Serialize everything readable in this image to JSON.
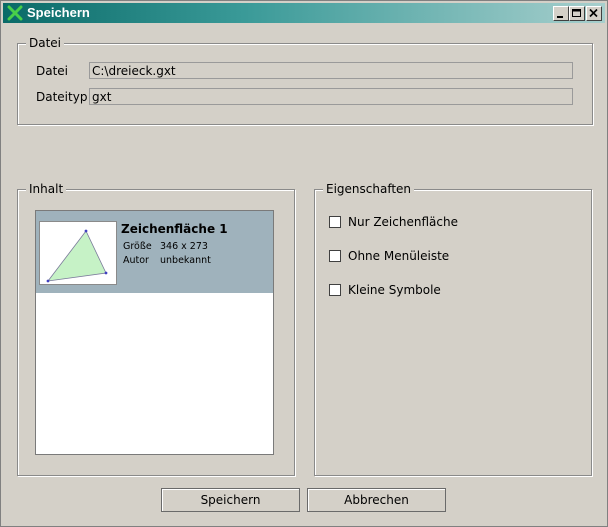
{
  "window": {
    "title": "Speichern"
  },
  "datei_group": {
    "legend": "Datei",
    "datei_label": "Datei",
    "datei_value": "C:\\dreieck.gxt",
    "dateityp_label": "Dateityp",
    "dateityp_value": "gxt"
  },
  "inhalt_group": {
    "legend": "Inhalt",
    "items": [
      {
        "title": "Zeichenfläche 1",
        "size_label": "Größe",
        "size_value": "346 x 273",
        "author_label": "Autor",
        "author_value": "unbekannt"
      }
    ]
  },
  "eigenschaften_group": {
    "legend": "Eigenschaften",
    "options": [
      {
        "label": "Nur Zeichenfläche",
        "checked": false
      },
      {
        "label": "Ohne Menüleiste",
        "checked": false
      },
      {
        "label": "Kleine Symbole",
        "checked": false
      }
    ]
  },
  "buttons": {
    "save": "Speichern",
    "cancel": "Abbrechen"
  },
  "colors": {
    "titlebar": "#0a6a68",
    "selection": "#9fb2bc",
    "window_bg": "#d4d0c8"
  }
}
